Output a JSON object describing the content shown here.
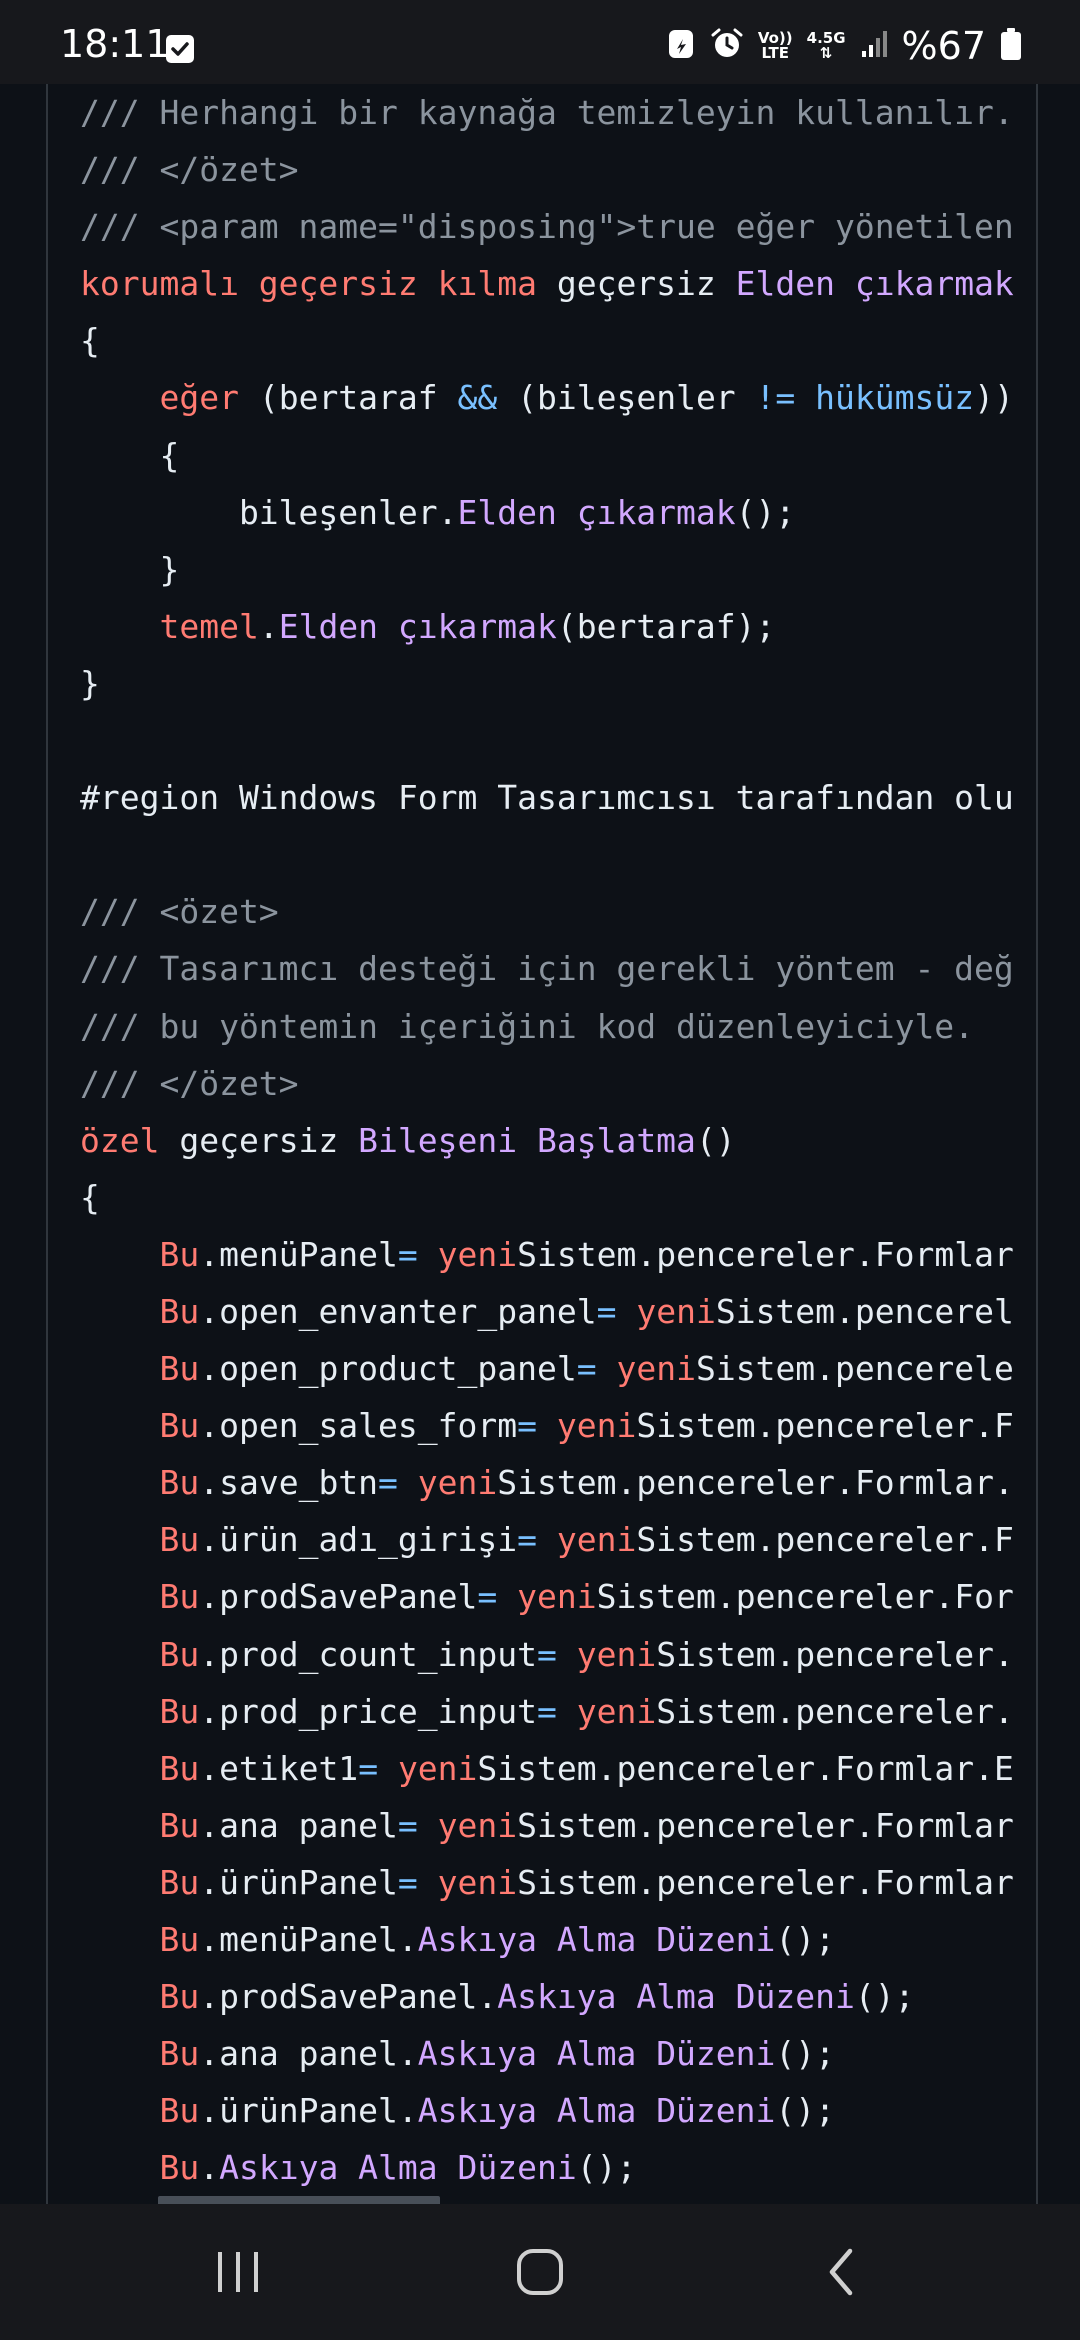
{
  "status_bar": {
    "time": "18:11",
    "network_label_top": "Vo))",
    "network_label_bottom": "LTE",
    "network_gen": "4.5G",
    "battery_percent": "%67",
    "icons": [
      "check-notification-icon",
      "data-saver-icon",
      "alarm-icon",
      "volte-icon",
      "network-arrows-icon",
      "signal-icon",
      "battery-icon"
    ]
  },
  "code": {
    "lines": [
      [
        {
          "t": "/// Herhangi bir kaynağa temizleyin kullanılır.",
          "c": "comment"
        }
      ],
      [
        {
          "t": "/// </özet>",
          "c": "comment"
        }
      ],
      [
        {
          "t": "/// <param name=\"disposing\">true eğer yönetilen",
          "c": "comment"
        }
      ],
      [
        {
          "t": "korumalı geçersiz kılma",
          "c": "kw"
        },
        {
          "t": " geçersiz ",
          "c": "plain"
        },
        {
          "t": "Elden çıkarmak",
          "c": "fn"
        }
      ],
      [
        {
          "t": "{",
          "c": "plain"
        }
      ],
      [
        {
          "t": "    ",
          "c": "plain"
        },
        {
          "t": "eğer",
          "c": "kw"
        },
        {
          "t": " (bertaraf ",
          "c": "plain"
        },
        {
          "t": "&&",
          "c": "const"
        },
        {
          "t": " (bileşenler ",
          "c": "plain"
        },
        {
          "t": "!=",
          "c": "const"
        },
        {
          "t": " ",
          "c": "plain"
        },
        {
          "t": "hükümsüz",
          "c": "const"
        },
        {
          "t": "))",
          "c": "plain"
        }
      ],
      [
        {
          "t": "    {",
          "c": "plain"
        }
      ],
      [
        {
          "t": "        bileşenler.",
          "c": "plain"
        },
        {
          "t": "Elden çıkarmak",
          "c": "fn"
        },
        {
          "t": "();",
          "c": "plain"
        }
      ],
      [
        {
          "t": "    }",
          "c": "plain"
        }
      ],
      [
        {
          "t": "    ",
          "c": "plain"
        },
        {
          "t": "temel",
          "c": "kw"
        },
        {
          "t": ".",
          "c": "plain"
        },
        {
          "t": "Elden çıkarmak",
          "c": "fn"
        },
        {
          "t": "(bertaraf);",
          "c": "plain"
        }
      ],
      [
        {
          "t": "}",
          "c": "plain"
        }
      ],
      [
        {
          "t": "",
          "c": "plain"
        }
      ],
      [
        {
          "t": "#region Windows Form Tasarımcısı tarafından olu",
          "c": "plain"
        }
      ],
      [
        {
          "t": "",
          "c": "plain"
        }
      ],
      [
        {
          "t": "/// <özet>",
          "c": "comment"
        }
      ],
      [
        {
          "t": "/// Tasarımcı desteği için gerekli yöntem - değ",
          "c": "comment"
        }
      ],
      [
        {
          "t": "/// bu yöntemin içeriğini kod düzenleyiciyle.",
          "c": "comment"
        }
      ],
      [
        {
          "t": "/// </özet>",
          "c": "comment"
        }
      ],
      [
        {
          "t": "özel",
          "c": "kw"
        },
        {
          "t": " geçersiz ",
          "c": "plain"
        },
        {
          "t": "Bileşeni Başlatma",
          "c": "fn"
        },
        {
          "t": "()",
          "c": "plain"
        }
      ],
      [
        {
          "t": "{",
          "c": "plain"
        }
      ],
      [
        {
          "t": "    ",
          "c": "plain"
        },
        {
          "t": "Bu",
          "c": "kw"
        },
        {
          "t": ".menüPanel",
          "c": "plain"
        },
        {
          "t": "=",
          "c": "const"
        },
        {
          "t": " ",
          "c": "plain"
        },
        {
          "t": "yeni",
          "c": "kw"
        },
        {
          "t": "Sistem.pencereler.Formlar",
          "c": "plain"
        }
      ],
      [
        {
          "t": "    ",
          "c": "plain"
        },
        {
          "t": "Bu",
          "c": "kw"
        },
        {
          "t": ".open_envanter_panel",
          "c": "plain"
        },
        {
          "t": "=",
          "c": "const"
        },
        {
          "t": " ",
          "c": "plain"
        },
        {
          "t": "yeni",
          "c": "kw"
        },
        {
          "t": "Sistem.pencerel",
          "c": "plain"
        }
      ],
      [
        {
          "t": "    ",
          "c": "plain"
        },
        {
          "t": "Bu",
          "c": "kw"
        },
        {
          "t": ".open_product_panel",
          "c": "plain"
        },
        {
          "t": "=",
          "c": "const"
        },
        {
          "t": " ",
          "c": "plain"
        },
        {
          "t": "yeni",
          "c": "kw"
        },
        {
          "t": "Sistem.pencerele",
          "c": "plain"
        }
      ],
      [
        {
          "t": "    ",
          "c": "plain"
        },
        {
          "t": "Bu",
          "c": "kw"
        },
        {
          "t": ".open_sales_form",
          "c": "plain"
        },
        {
          "t": "=",
          "c": "const"
        },
        {
          "t": " ",
          "c": "plain"
        },
        {
          "t": "yeni",
          "c": "kw"
        },
        {
          "t": "Sistem.pencereler.F",
          "c": "plain"
        }
      ],
      [
        {
          "t": "    ",
          "c": "plain"
        },
        {
          "t": "Bu",
          "c": "kw"
        },
        {
          "t": ".save_btn",
          "c": "plain"
        },
        {
          "t": "=",
          "c": "const"
        },
        {
          "t": " ",
          "c": "plain"
        },
        {
          "t": "yeni",
          "c": "kw"
        },
        {
          "t": "Sistem.pencereler.Formlar.",
          "c": "plain"
        }
      ],
      [
        {
          "t": "    ",
          "c": "plain"
        },
        {
          "t": "Bu",
          "c": "kw"
        },
        {
          "t": ".ürün_adı_girişi",
          "c": "plain"
        },
        {
          "t": "=",
          "c": "const"
        },
        {
          "t": " ",
          "c": "plain"
        },
        {
          "t": "yeni",
          "c": "kw"
        },
        {
          "t": "Sistem.pencereler.F",
          "c": "plain"
        }
      ],
      [
        {
          "t": "    ",
          "c": "plain"
        },
        {
          "t": "Bu",
          "c": "kw"
        },
        {
          "t": ".prodSavePanel",
          "c": "plain"
        },
        {
          "t": "=",
          "c": "const"
        },
        {
          "t": " ",
          "c": "plain"
        },
        {
          "t": "yeni",
          "c": "kw"
        },
        {
          "t": "Sistem.pencereler.For",
          "c": "plain"
        }
      ],
      [
        {
          "t": "    ",
          "c": "plain"
        },
        {
          "t": "Bu",
          "c": "kw"
        },
        {
          "t": ".prod_count_input",
          "c": "plain"
        },
        {
          "t": "=",
          "c": "const"
        },
        {
          "t": " ",
          "c": "plain"
        },
        {
          "t": "yeni",
          "c": "kw"
        },
        {
          "t": "Sistem.pencereler.",
          "c": "plain"
        }
      ],
      [
        {
          "t": "    ",
          "c": "plain"
        },
        {
          "t": "Bu",
          "c": "kw"
        },
        {
          "t": ".prod_price_input",
          "c": "plain"
        },
        {
          "t": "=",
          "c": "const"
        },
        {
          "t": " ",
          "c": "plain"
        },
        {
          "t": "yeni",
          "c": "kw"
        },
        {
          "t": "Sistem.pencereler.",
          "c": "plain"
        }
      ],
      [
        {
          "t": "    ",
          "c": "plain"
        },
        {
          "t": "Bu",
          "c": "kw"
        },
        {
          "t": ".etiket1",
          "c": "plain"
        },
        {
          "t": "=",
          "c": "const"
        },
        {
          "t": " ",
          "c": "plain"
        },
        {
          "t": "yeni",
          "c": "kw"
        },
        {
          "t": "Sistem.pencereler.Formlar.E",
          "c": "plain"
        }
      ],
      [
        {
          "t": "    ",
          "c": "plain"
        },
        {
          "t": "Bu",
          "c": "kw"
        },
        {
          "t": ".ana panel",
          "c": "plain"
        },
        {
          "t": "=",
          "c": "const"
        },
        {
          "t": " ",
          "c": "plain"
        },
        {
          "t": "yeni",
          "c": "kw"
        },
        {
          "t": "Sistem.pencereler.Formlar",
          "c": "plain"
        }
      ],
      [
        {
          "t": "    ",
          "c": "plain"
        },
        {
          "t": "Bu",
          "c": "kw"
        },
        {
          "t": ".ürünPanel",
          "c": "plain"
        },
        {
          "t": "=",
          "c": "const"
        },
        {
          "t": " ",
          "c": "plain"
        },
        {
          "t": "yeni",
          "c": "kw"
        },
        {
          "t": "Sistem.pencereler.Formlar",
          "c": "plain"
        }
      ],
      [
        {
          "t": "    ",
          "c": "plain"
        },
        {
          "t": "Bu",
          "c": "kw"
        },
        {
          "t": ".menüPanel.",
          "c": "plain"
        },
        {
          "t": "Askıya Alma Düzeni",
          "c": "fn"
        },
        {
          "t": "();",
          "c": "plain"
        }
      ],
      [
        {
          "t": "    ",
          "c": "plain"
        },
        {
          "t": "Bu",
          "c": "kw"
        },
        {
          "t": ".prodSavePanel.",
          "c": "plain"
        },
        {
          "t": "Askıya Alma Düzeni",
          "c": "fn"
        },
        {
          "t": "();",
          "c": "plain"
        }
      ],
      [
        {
          "t": "    ",
          "c": "plain"
        },
        {
          "t": "Bu",
          "c": "kw"
        },
        {
          "t": ".ana panel.",
          "c": "plain"
        },
        {
          "t": "Askıya Alma Düzeni",
          "c": "fn"
        },
        {
          "t": "();",
          "c": "plain"
        }
      ],
      [
        {
          "t": "    ",
          "c": "plain"
        },
        {
          "t": "Bu",
          "c": "kw"
        },
        {
          "t": ".ürünPanel.",
          "c": "plain"
        },
        {
          "t": "Askıya Alma Düzeni",
          "c": "fn"
        },
        {
          "t": "();",
          "c": "plain"
        }
      ],
      [
        {
          "t": "    ",
          "c": "plain"
        },
        {
          "t": "Bu",
          "c": "kw"
        },
        {
          "t": ".",
          "c": "plain"
        },
        {
          "t": "Askıya Alma Düzeni",
          "c": "fn"
        },
        {
          "t": "();",
          "c": "plain"
        }
      ]
    ]
  },
  "colors": {
    "background": "#0d1117",
    "comment": "#8b949e",
    "keyword": "#ff7b72",
    "function": "#d2a8ff",
    "constant": "#79c0ff",
    "plain": "#e6edf3"
  },
  "nav_bar": {
    "buttons": [
      "recent-apps-icon",
      "home-icon",
      "back-icon"
    ]
  }
}
